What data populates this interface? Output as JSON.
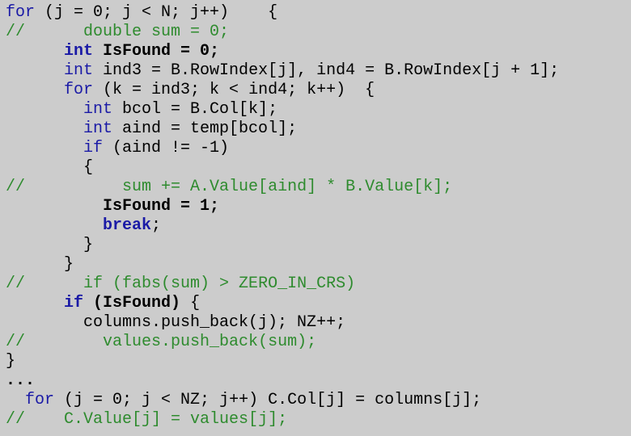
{
  "editor": {
    "background": "#cccccc",
    "colors": {
      "keyword": "#1a1aa6",
      "comment": "#2e8b2e",
      "text": "#000000"
    },
    "lines": [
      [
        {
          "t": "kw",
          "s": "for"
        },
        {
          "t": "n",
          "s": " (j = 0; j < N; j++)    {"
        }
      ],
      [
        {
          "t": "cs",
          "s": "//"
        },
        {
          "t": "cm",
          "s": "      double sum = 0;"
        }
      ],
      [
        {
          "t": "n",
          "s": "      "
        },
        {
          "t": "kwb",
          "s": "int"
        },
        {
          "t": "b",
          "s": " IsFound = 0;"
        }
      ],
      [
        {
          "t": "n",
          "s": "      "
        },
        {
          "t": "kw",
          "s": "int"
        },
        {
          "t": "n",
          "s": " ind3 = B.RowIndex[j], ind4 = B.RowIndex[j + 1];"
        }
      ],
      [
        {
          "t": "n",
          "s": "      "
        },
        {
          "t": "kw",
          "s": "for"
        },
        {
          "t": "n",
          "s": " (k = ind3; k < ind4; k++)  {"
        }
      ],
      [
        {
          "t": "n",
          "s": "        "
        },
        {
          "t": "kw",
          "s": "int"
        },
        {
          "t": "n",
          "s": " bcol = B.Col[k];"
        }
      ],
      [
        {
          "t": "n",
          "s": "        "
        },
        {
          "t": "kw",
          "s": "int"
        },
        {
          "t": "n",
          "s": " aind = temp[bcol];"
        }
      ],
      [
        {
          "t": "n",
          "s": "        "
        },
        {
          "t": "kw",
          "s": "if"
        },
        {
          "t": "n",
          "s": " (aind != -1)"
        }
      ],
      [
        {
          "t": "n",
          "s": "        {"
        }
      ],
      [
        {
          "t": "cs",
          "s": "//"
        },
        {
          "t": "cm",
          "s": "          sum += A.Value[aind] * B.Value[k];"
        }
      ],
      [
        {
          "t": "n",
          "s": "          "
        },
        {
          "t": "b",
          "s": "IsFound = 1;"
        }
      ],
      [
        {
          "t": "n",
          "s": "          "
        },
        {
          "t": "kwb",
          "s": "break"
        },
        {
          "t": "n",
          "s": ";"
        }
      ],
      [
        {
          "t": "n",
          "s": "        }"
        }
      ],
      [
        {
          "t": "n",
          "s": "      }"
        }
      ],
      [
        {
          "t": "cs",
          "s": "//"
        },
        {
          "t": "cm",
          "s": "      if (fabs(sum) > ZERO_IN_CRS)"
        }
      ],
      [
        {
          "t": "n",
          "s": "      "
        },
        {
          "t": "kwb",
          "s": "if"
        },
        {
          "t": "b",
          "s": " (IsFound)"
        },
        {
          "t": "n",
          "s": " {"
        }
      ],
      [
        {
          "t": "n",
          "s": "        columns.push_back(j); NZ++;"
        }
      ],
      [
        {
          "t": "cs",
          "s": "//"
        },
        {
          "t": "cm",
          "s": "        values.push_back(sum);"
        }
      ],
      [
        {
          "t": "n",
          "s": "}"
        }
      ],
      [
        {
          "t": "b",
          "s": "..."
        }
      ],
      [
        {
          "t": "n",
          "s": "  "
        },
        {
          "t": "kw",
          "s": "for"
        },
        {
          "t": "n",
          "s": " (j = 0; j < NZ; j++) C.Col[j] = columns[j];"
        }
      ],
      [
        {
          "t": "cs",
          "s": "//"
        },
        {
          "t": "cm",
          "s": "    C.Value[j] = values[j];"
        }
      ]
    ]
  }
}
